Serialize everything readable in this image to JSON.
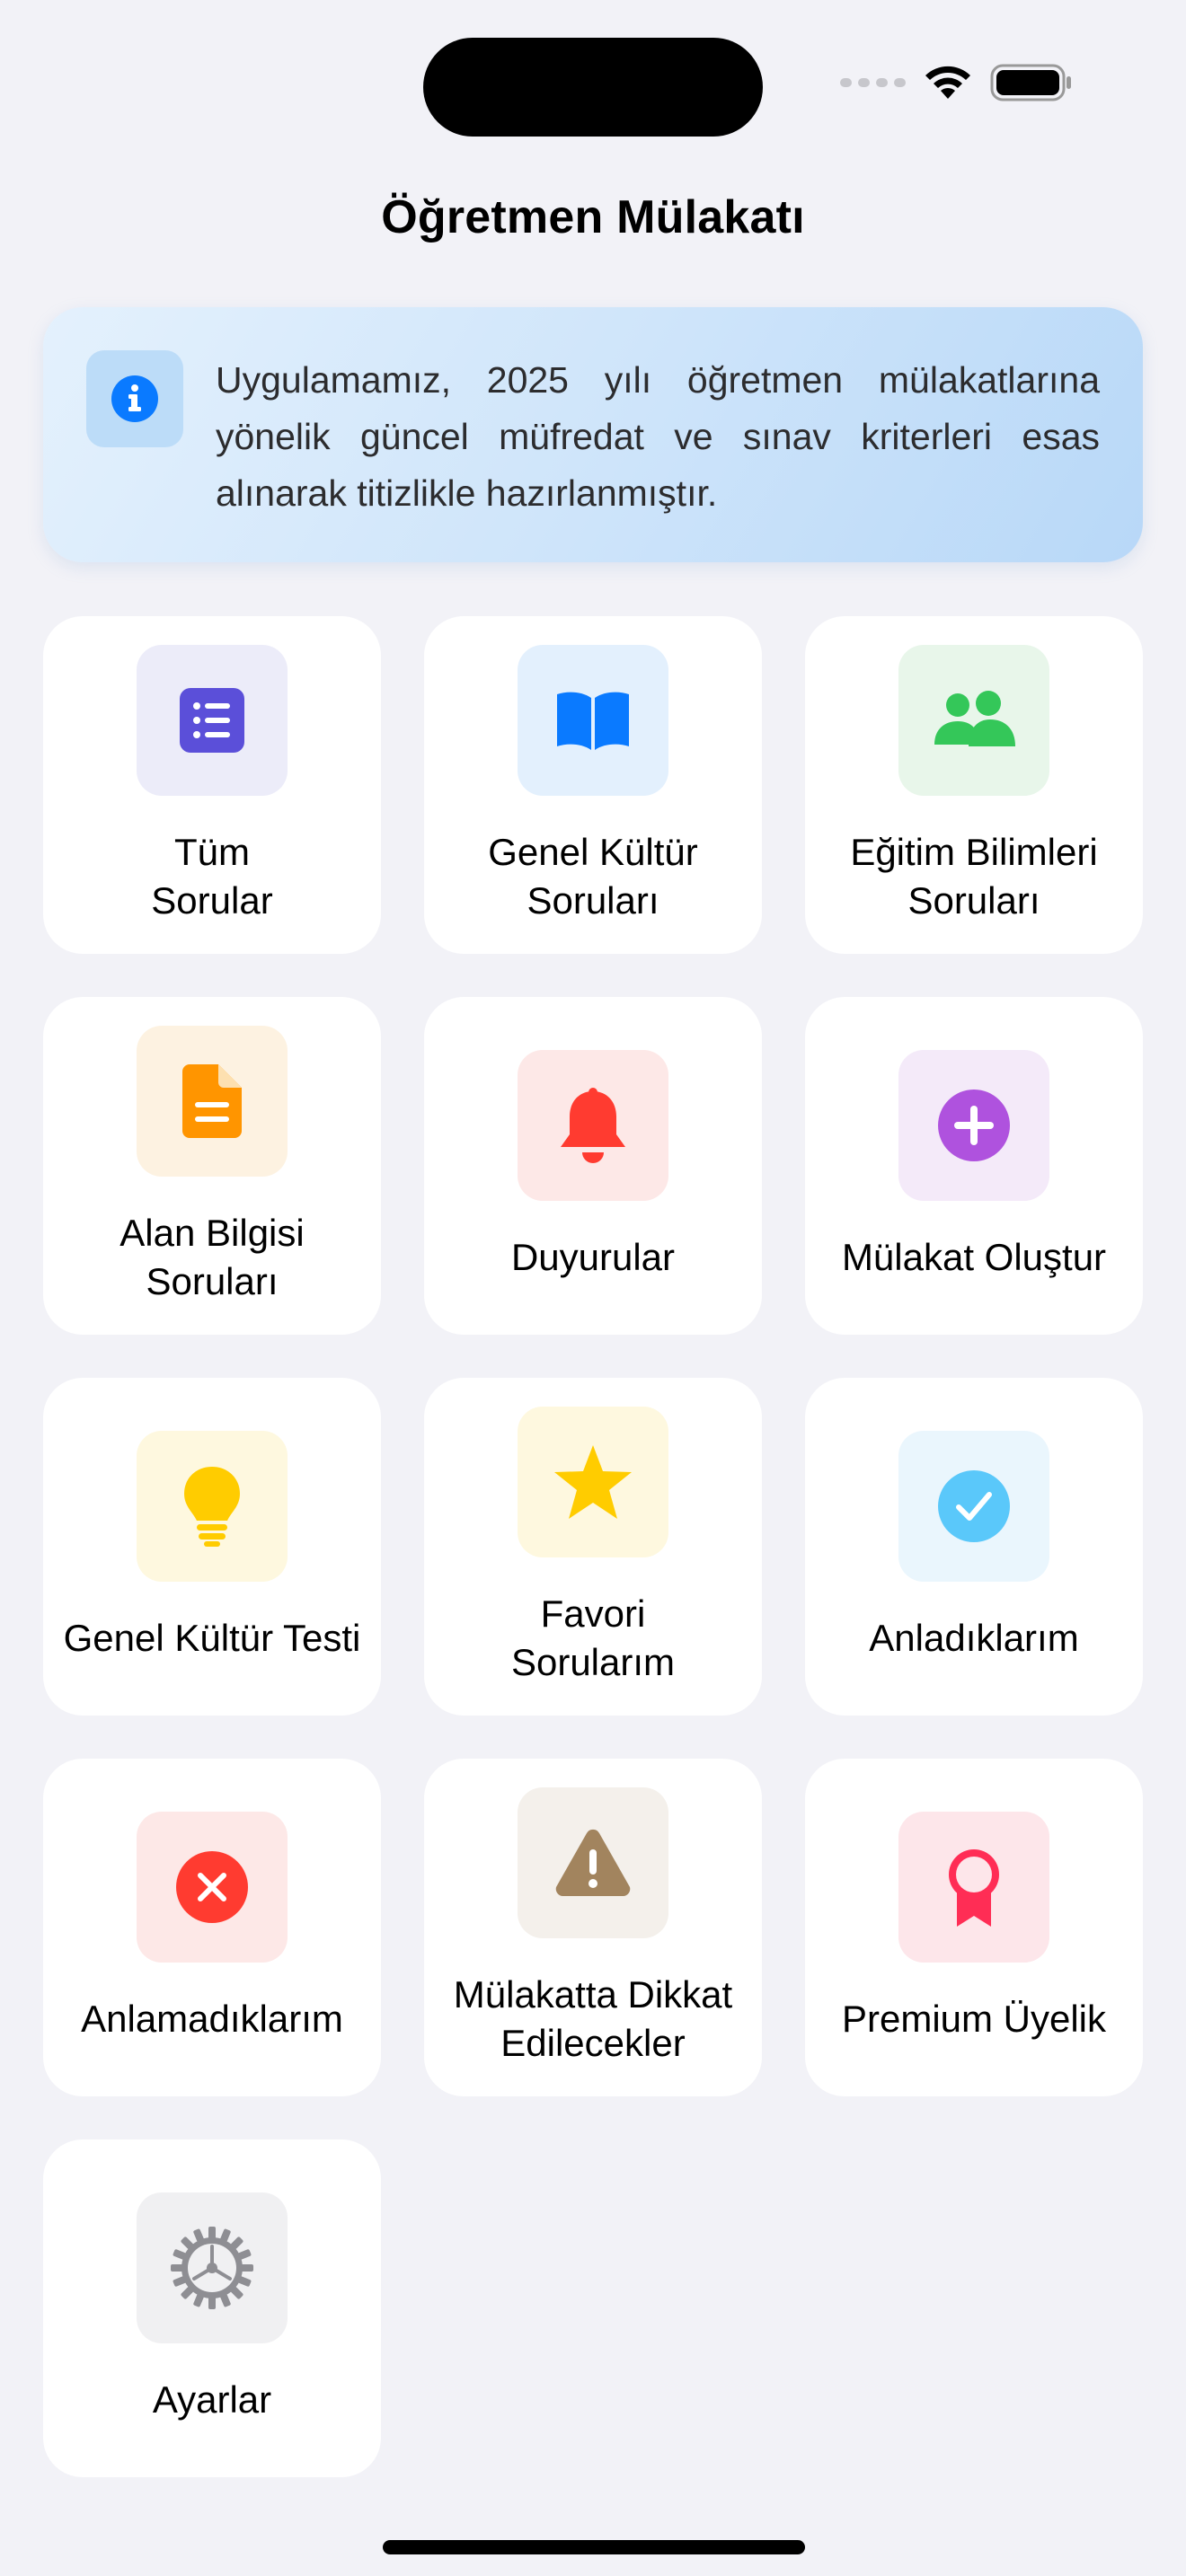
{
  "header": {
    "title": "Öğretmen Mülakatı"
  },
  "banner": {
    "text": "Uygulamamız, 2025 yılı öğretmen mülakatlarına yönelik güncel müfredat ve sınav kriterleri esas alınarak titizlikle hazırlanmıştır."
  },
  "menu": [
    {
      "label": "Tüm\nSorular",
      "icon": "list-icon",
      "color": "#5b4fd9",
      "bg": "#ececf9"
    },
    {
      "label": "Genel Kültür\nSoruları",
      "icon": "book-icon",
      "color": "#0a7aff",
      "bg": "#e3f0fd"
    },
    {
      "label": "Eğitim Bilimleri\nSoruları",
      "icon": "people-icon",
      "color": "#34c759",
      "bg": "#e8f6ea"
    },
    {
      "label": "Alan Bilgisi\nSoruları",
      "icon": "document-icon",
      "color": "#ff9500",
      "bg": "#fdf2e1"
    },
    {
      "label": "Duyurular",
      "icon": "bell-icon",
      "color": "#ff3b30",
      "bg": "#fde8e7"
    },
    {
      "label": "Mülakat Oluştur",
      "icon": "plus-circle-icon",
      "color": "#af52de",
      "bg": "#f4eaf9"
    },
    {
      "label": "Genel Kültür Testi",
      "icon": "lightbulb-icon",
      "color": "#ffcc00",
      "bg": "#fef8df"
    },
    {
      "label": "Favori\nSorularım",
      "icon": "star-icon",
      "color": "#ffcc00",
      "bg": "#fef8df"
    },
    {
      "label": "Anladıklarım",
      "icon": "checkmark-circle-icon",
      "color": "#5ac8fa",
      "bg": "#eaf6fd"
    },
    {
      "label": "Anlamadıklarım",
      "icon": "x-circle-icon",
      "color": "#ff3b30",
      "bg": "#fde8e7"
    },
    {
      "label": "Mülakatta Dikkat\nEdilecekler",
      "icon": "warning-icon",
      "color": "#a2845e",
      "bg": "#f4f0eb"
    },
    {
      "label": "Premium Üyelik",
      "icon": "ribbon-icon",
      "color": "#ff2d55",
      "bg": "#fde6ea"
    },
    {
      "label": "Ayarlar",
      "icon": "gear-icon",
      "color": "#8e8e93",
      "bg": "#f0f0f2"
    }
  ]
}
